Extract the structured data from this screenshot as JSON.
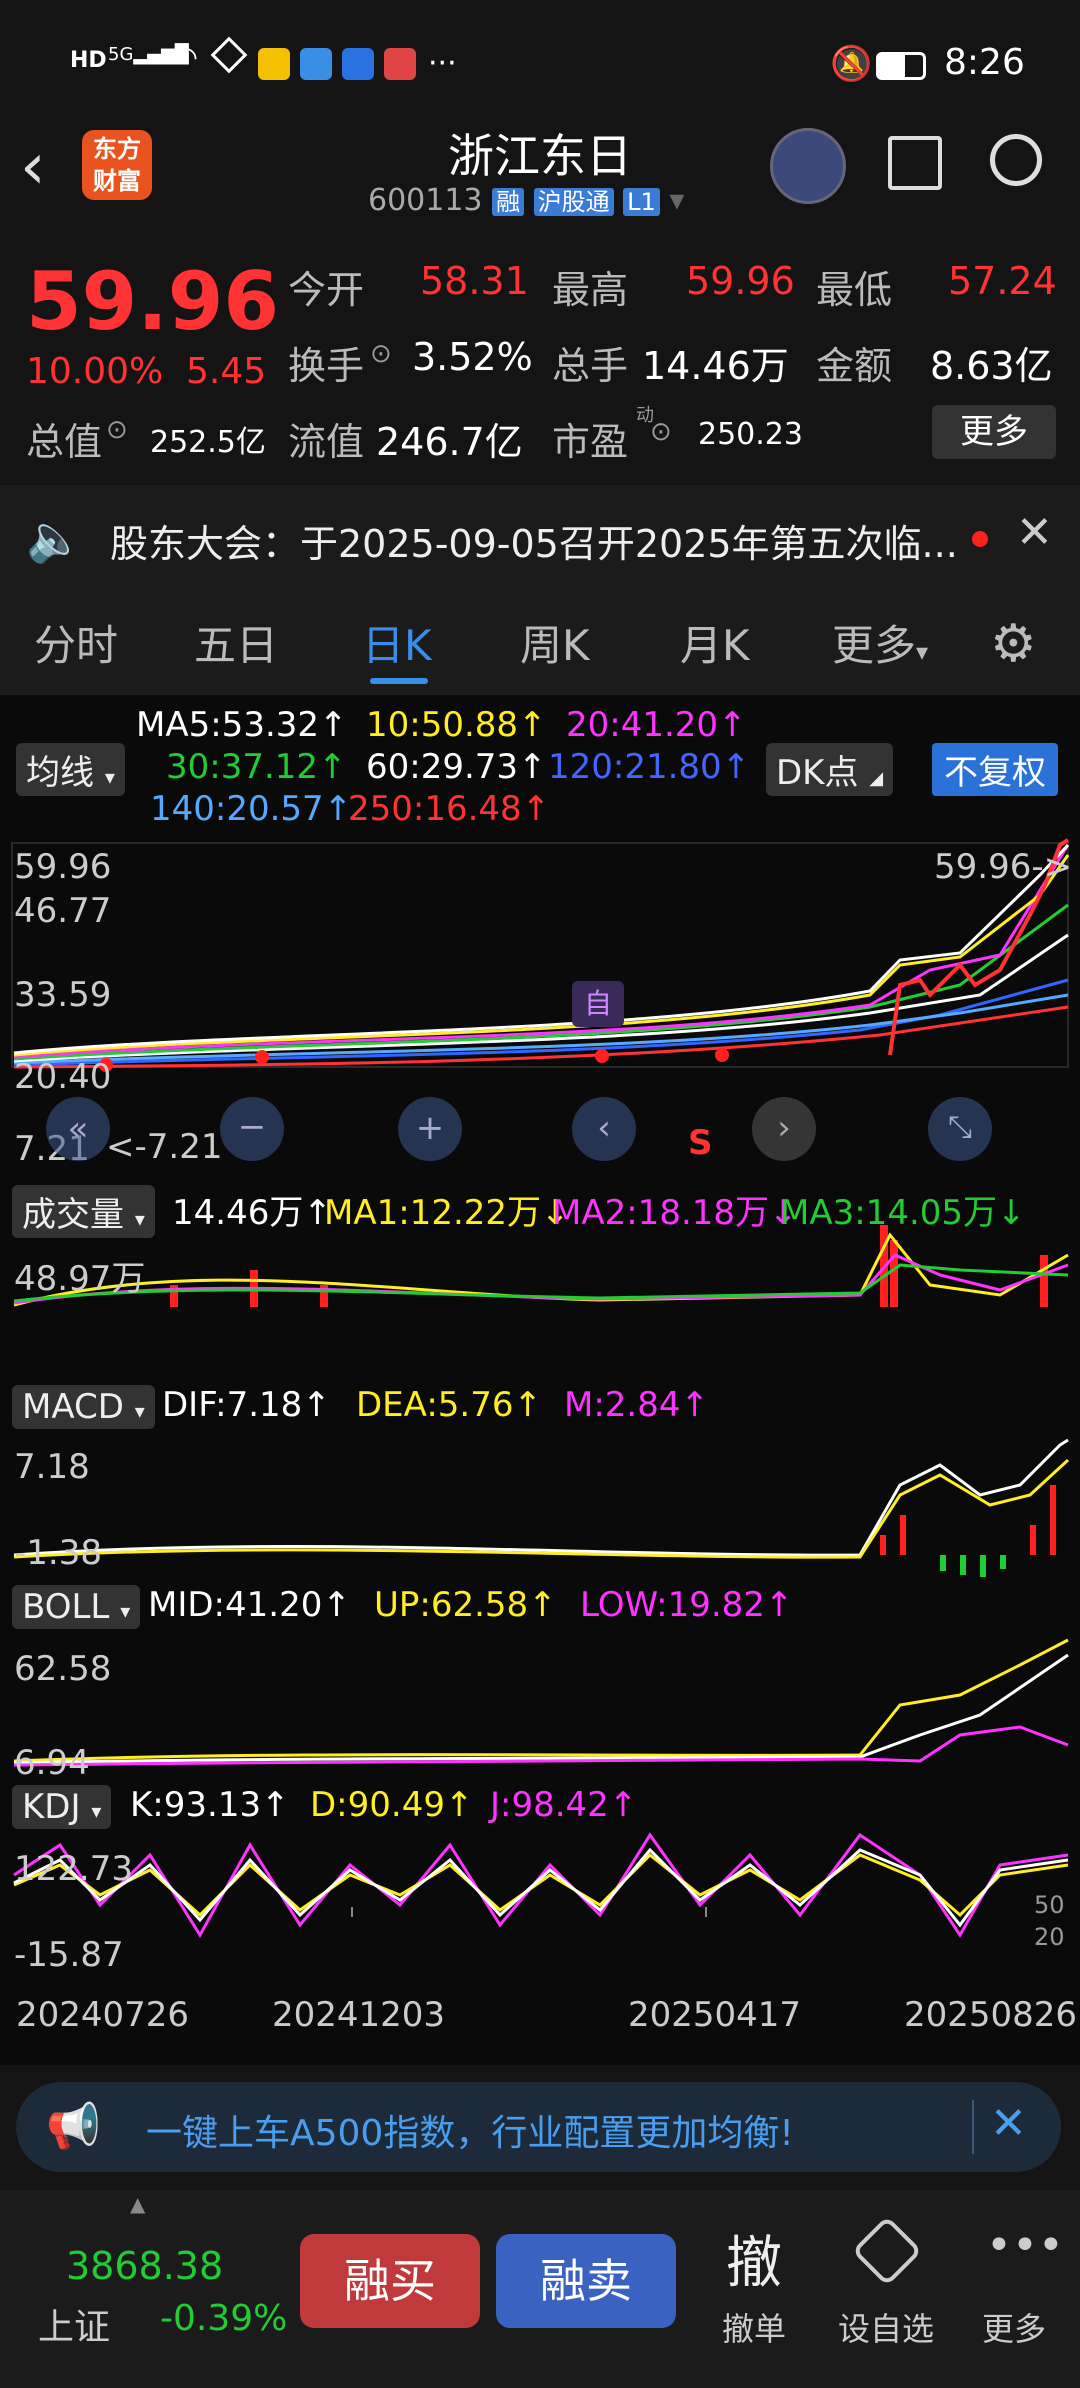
{
  "status": {
    "time": "8:26",
    "left_icons": [
      "HD",
      "5G",
      "signal",
      "wifi",
      "nfc",
      "weibo",
      "browser",
      "mail",
      "app",
      "more"
    ],
    "more": "···"
  },
  "header": {
    "title": "浙江东日",
    "code": "600113",
    "tag_rong": "融",
    "tag_hgt": "沪股通",
    "tag_l1": "L1",
    "logo_line1": "东方",
    "logo_line2": "财富"
  },
  "quote": {
    "price": "59.96",
    "pct": "10.00%",
    "change": "5.45",
    "open_label": "今开",
    "open": "58.31",
    "high_label": "最高",
    "high": "59.96",
    "low_label": "最低",
    "low": "57.24",
    "turnover_label": "换手",
    "turnover": "3.52%",
    "volume_label": "总手",
    "volume": "14.46万",
    "amount_label": "金额",
    "amount": "8.63亿",
    "mcap_label": "总值",
    "mcap": "252.5亿",
    "float_label": "流值",
    "float": "246.7亿",
    "pe_label": "市盈",
    "pe_sup": "动",
    "pe": "250.23",
    "more_btn": "更多"
  },
  "notice": {
    "text": "股东大会：于2025-09-05召开2025年第五次临..."
  },
  "tabs": [
    "分时",
    "五日",
    "日K",
    "周K",
    "月K",
    "更多"
  ],
  "active_tab": "日K",
  "ma": {
    "ma5": "MA5:53.32",
    "ma10": "10:50.88",
    "ma20": "20:41.20",
    "ma30": "30:37.12",
    "ma60": "60:29.73",
    "ma120": "120:21.80",
    "ma140": "140:20.57",
    "ma250": "250:16.48",
    "selector": "均线",
    "dk": "DK点",
    "fq": "不复权"
  },
  "kline": {
    "y1": "59.96",
    "y2": "46.77",
    "y3": "33.59",
    "y4": "20.40",
    "y5": "7.21",
    "low_mark": "<-7.21",
    "high_mark": "59.96->",
    "self_mark": "自",
    "s_mark": "S"
  },
  "vol": {
    "selector": "成交量",
    "v": "14.46万",
    "ma1": "MA1:12.22万",
    "ma2": "MA2:18.18万",
    "ma3": "MA3:14.05万",
    "y1": "48.97万"
  },
  "macd": {
    "selector": "MACD",
    "dif": "DIF:7.18",
    "dea": "DEA:5.76",
    "m": "M:2.84",
    "y1": "7.18",
    "y2": "-1.38"
  },
  "boll": {
    "selector": "BOLL",
    "mid": "MID:41.20",
    "up": "UP:62.58",
    "low": "LOW:19.82",
    "y1": "62.58",
    "y2": "6.94"
  },
  "kdj": {
    "selector": "KDJ",
    "k": "K:93.13",
    "d": "D:90.49",
    "j": "J:98.42",
    "y1": "122.73",
    "y2": "-15.87",
    "r1": "50",
    "r2": "20"
  },
  "dates": [
    "20240726",
    "20241203",
    "20250417",
    "20250826"
  ],
  "banner": {
    "text": "一键上车A500指数，行业配置更加均衡!"
  },
  "bottom": {
    "index_value": "3868.38",
    "index_name": "上证",
    "index_pct": "-0.39%",
    "buy": "融买",
    "sell": "融卖",
    "cancel_icon": "撤",
    "cancel": "撤单",
    "watch": "设自选",
    "more": "更多"
  },
  "colors": {
    "up": "#ff3333",
    "down": "#22cc33",
    "accent": "#3a7bd5",
    "bg": "#0a0a0a"
  }
}
